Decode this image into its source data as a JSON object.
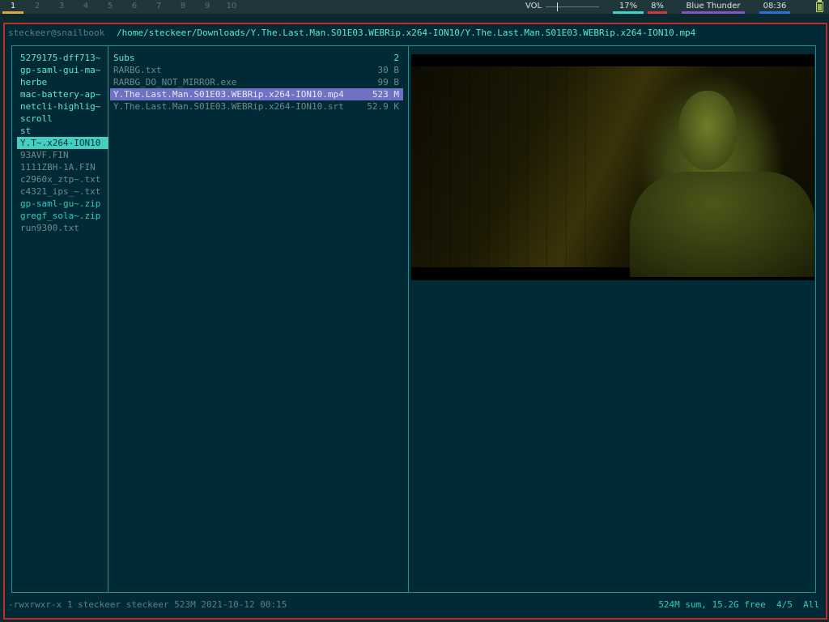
{
  "topbar": {
    "workspaces": [
      "1",
      "2",
      "3",
      "4",
      "5",
      "6",
      "7",
      "8",
      "9",
      "10"
    ],
    "active_workspace": "1",
    "volume_label": "VOL",
    "cpu": "17%",
    "mem": "8%",
    "theme": "Blue Thunder",
    "clock": "08:36"
  },
  "colors": {
    "frame_border": "#c42a2a",
    "terminal_bg": "#002a35",
    "directory": "#60e6d8",
    "file": "#6e8b8a",
    "archive": "#c23a3a",
    "selection_left": "#44cfc1",
    "selection_main": "#6f71c2"
  },
  "header": {
    "user": "steckeer@snailbook",
    "path": "/home/steckeer/Downloads/Y.The.Last.Man.S01E03.WEBRip.x264-ION10/Y.The.Last.Man.S01E03.WEBRip.x264-ION10.mp4"
  },
  "parent_column": [
    {
      "name": "5279175-dff713~",
      "kind": "dir"
    },
    {
      "name": "gp-saml-gui-ma~",
      "kind": "dir"
    },
    {
      "name": "herbe",
      "kind": "dir"
    },
    {
      "name": "mac-battery-ap~",
      "kind": "dir"
    },
    {
      "name": "netcli-highlig~",
      "kind": "dir"
    },
    {
      "name": "scroll",
      "kind": "dir"
    },
    {
      "name": "st",
      "kind": "dir"
    },
    {
      "name": "Y.T~.x264-ION10",
      "kind": "dir",
      "selected": true
    },
    {
      "name": "93AVF.FIN",
      "kind": "file"
    },
    {
      "name": "1111ZBH-1A.FIN",
      "kind": "file"
    },
    {
      "name": "c2960x_ztp~.txt",
      "kind": "file"
    },
    {
      "name": "c4321_ips_~.txt",
      "kind": "file"
    },
    {
      "name": "gp-saml-gu~.zip",
      "kind": "archive"
    },
    {
      "name": "gregf_sola~.zip",
      "kind": "archive"
    },
    {
      "name": "run9300.txt",
      "kind": "file"
    }
  ],
  "main_column": [
    {
      "name": "Subs",
      "size": "2",
      "kind": "dir"
    },
    {
      "name": "RARBG.txt",
      "size": "30 B",
      "kind": "file"
    },
    {
      "name": "RARBG_DO_NOT_MIRROR.exe",
      "size": "99 B",
      "kind": "file"
    },
    {
      "name": "Y.The.Last.Man.S01E03.WEBRip.x264-ION10.mp4",
      "size": "523 M",
      "kind": "file",
      "selected": true
    },
    {
      "name": "Y.The.Last.Man.S01E03.WEBRip.x264-ION10.srt",
      "size": "52.9 K",
      "kind": "file"
    }
  ],
  "status": {
    "info": "-rwxrwxr-x 1 steckeer steckeer 523M 2021-10-12 00:15",
    "summary": "524M sum, 15.2G free  4/5  All"
  }
}
